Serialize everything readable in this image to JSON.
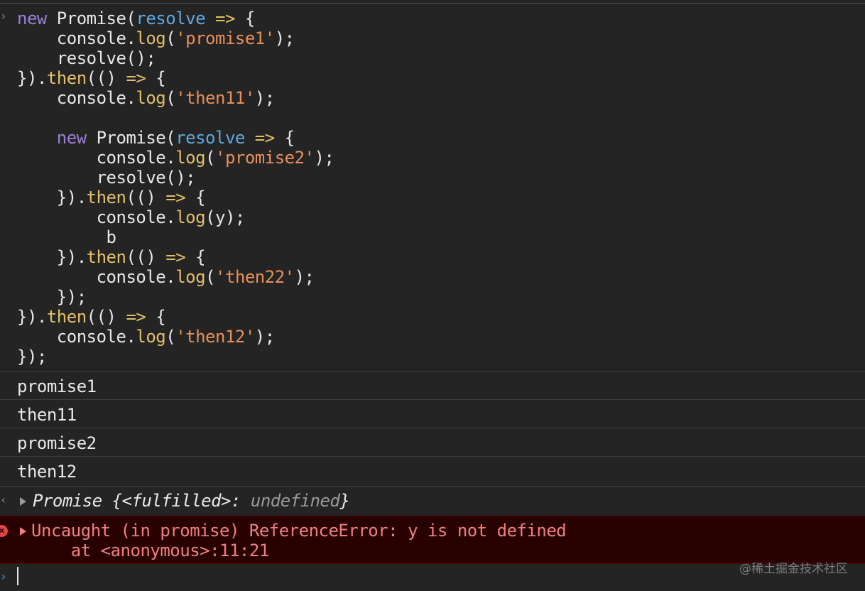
{
  "code": {
    "l1_kw": "new",
    "l1_cls": " Promise(",
    "l1_param": "resolve",
    "l1_arrow": " =>",
    "l1_end": " {",
    "l2_obj": "    console.",
    "l2_fn": "log",
    "l2_open": "(",
    "l2_str": "'promise1'",
    "l2_end": ");",
    "l3": "    resolve();",
    "l4_a": "}).",
    "l4_fn": "then",
    "l4_b": "(() ",
    "l4_arrow": "=>",
    "l4_c": " {",
    "l5_obj": "    console.",
    "l5_fn": "log",
    "l5_open": "(",
    "l5_str": "'then11'",
    "l5_end": ");",
    "l7_pre": "    ",
    "l7_kw": "new",
    "l7_cls": " Promise(",
    "l7_param": "resolve",
    "l7_arrow": " =>",
    "l7_end": " {",
    "l8_obj": "        console.",
    "l8_fn": "log",
    "l8_open": "(",
    "l8_str": "'promise2'",
    "l8_end": ");",
    "l9": "        resolve();",
    "l10_a": "    }).",
    "l10_fn": "then",
    "l10_b": "(() ",
    "l10_arrow": "=>",
    "l10_c": " {",
    "l11_obj": "        console.",
    "l11_fn": "log",
    "l11_end": "(y);",
    "l12": "         b",
    "l13_a": "    }).",
    "l13_fn": "then",
    "l13_b": "(() ",
    "l13_arrow": "=>",
    "l13_c": " {",
    "l14_obj": "        console.",
    "l14_fn": "log",
    "l14_open": "(",
    "l14_str": "'then22'",
    "l14_end": ");",
    "l15": "    });",
    "l16_a": "}).",
    "l16_fn": "then",
    "l16_b": "(() ",
    "l16_arrow": "=>",
    "l16_c": " {",
    "l17_obj": "    console.",
    "l17_fn": "log",
    "l17_open": "(",
    "l17_str": "'then12'",
    "l17_end": ");",
    "l18": "});"
  },
  "logs": [
    "promise1",
    "then11",
    "promise2",
    "then12"
  ],
  "result": {
    "prefix": "Promise {<fulfilled>: ",
    "value": "undefined",
    "suffix": "}"
  },
  "error": {
    "icon": "×",
    "line1": "Uncaught (in promise) ReferenceError: y is not defined",
    "line2": "    at <anonymous>:11:21"
  },
  "watermark": "@稀土掘金技术社区",
  "colors": {
    "background": "#242424",
    "keyword": "#9a7fd6",
    "parameter": "#5fa8e0",
    "function": "#e2c068",
    "string": "#e69058",
    "error_text": "#f08080",
    "error_background": "#290000"
  }
}
